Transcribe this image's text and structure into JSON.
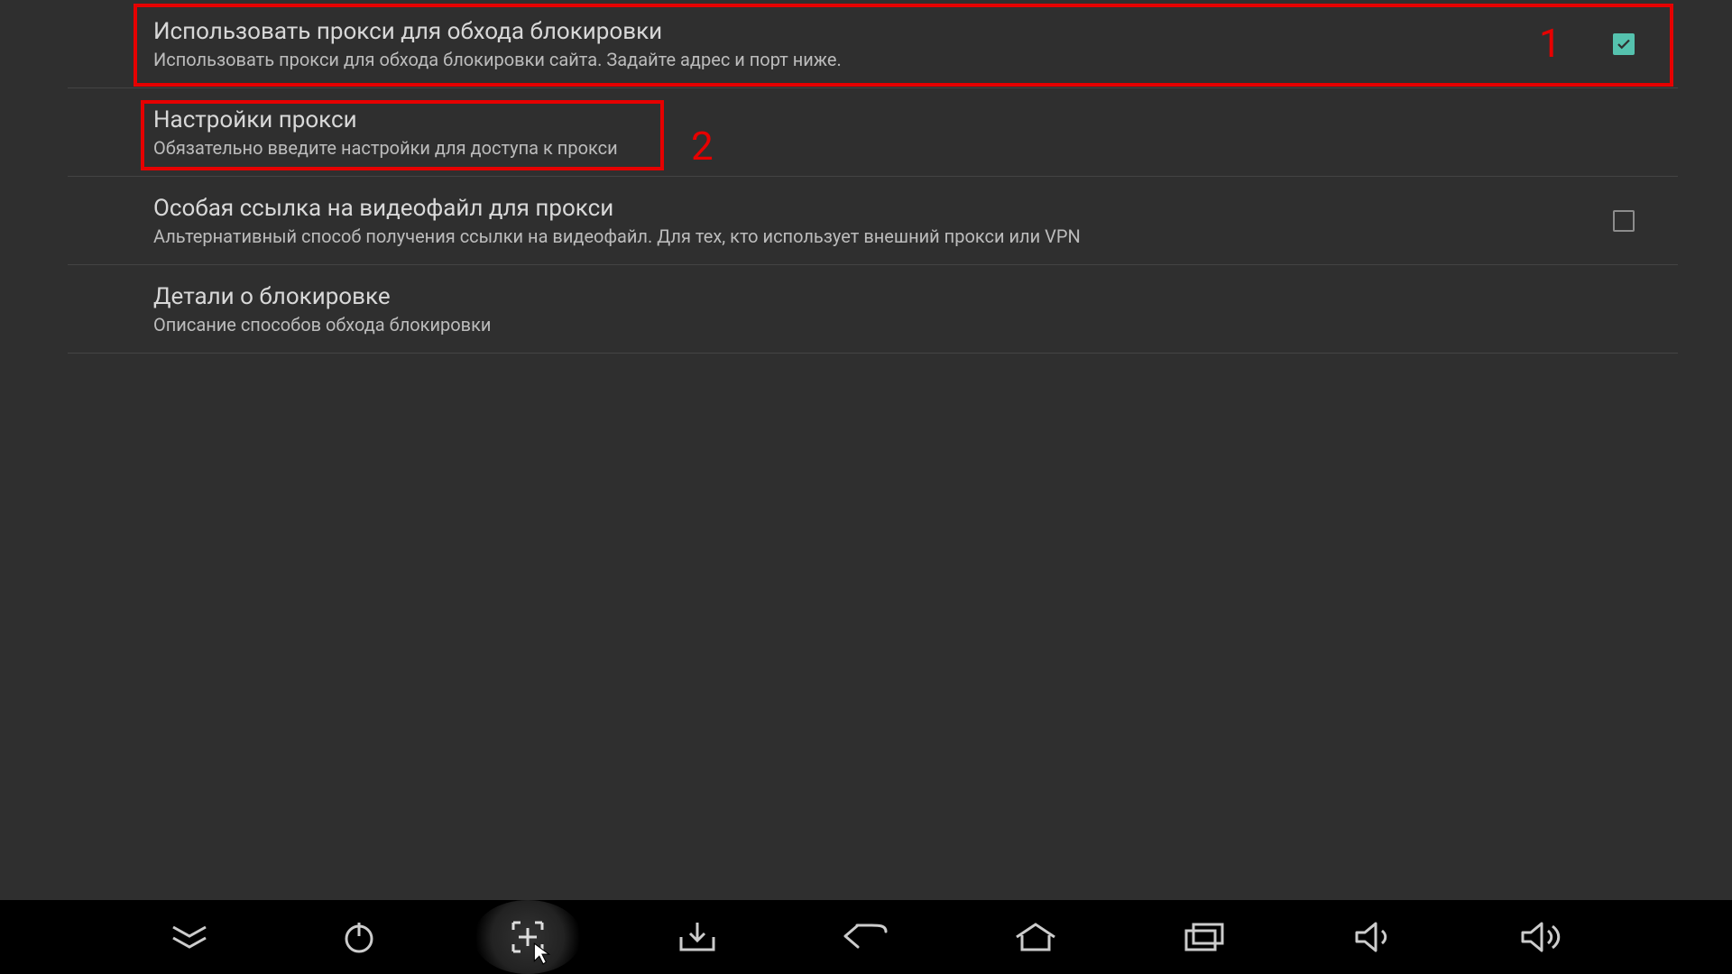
{
  "settings": [
    {
      "title": "Использовать прокси для обхода блокировки",
      "subtitle": "Использовать прокси для обхода блокировки сайта. Задайте адрес и порт ниже.",
      "has_checkbox": true,
      "checked": true
    },
    {
      "title": "Настройки прокси",
      "subtitle": "Обязательно введите настройки для доступа к прокси",
      "has_checkbox": false,
      "checked": false
    },
    {
      "title": "Особая ссылка на видеофайл для прокси",
      "subtitle": "Альтернативный способ получения ссылки на видеофайл. Для тех, кто использует внешний прокси или VPN",
      "has_checkbox": true,
      "checked": false
    },
    {
      "title": "Детали о блокировке",
      "subtitle": "Описание способов обхода блокировки",
      "has_checkbox": false,
      "checked": false
    }
  ],
  "annotations": {
    "label1": "1",
    "label2": "2"
  },
  "colors": {
    "accent": "#55c2ae",
    "annotation": "#e60000",
    "background": "#2f2f2f"
  },
  "navbar_icons": [
    "collapse-icon",
    "power-icon",
    "crosshair-icon",
    "download-icon",
    "back-icon",
    "home-icon",
    "recents-icon",
    "volume-down-icon",
    "volume-up-icon"
  ]
}
